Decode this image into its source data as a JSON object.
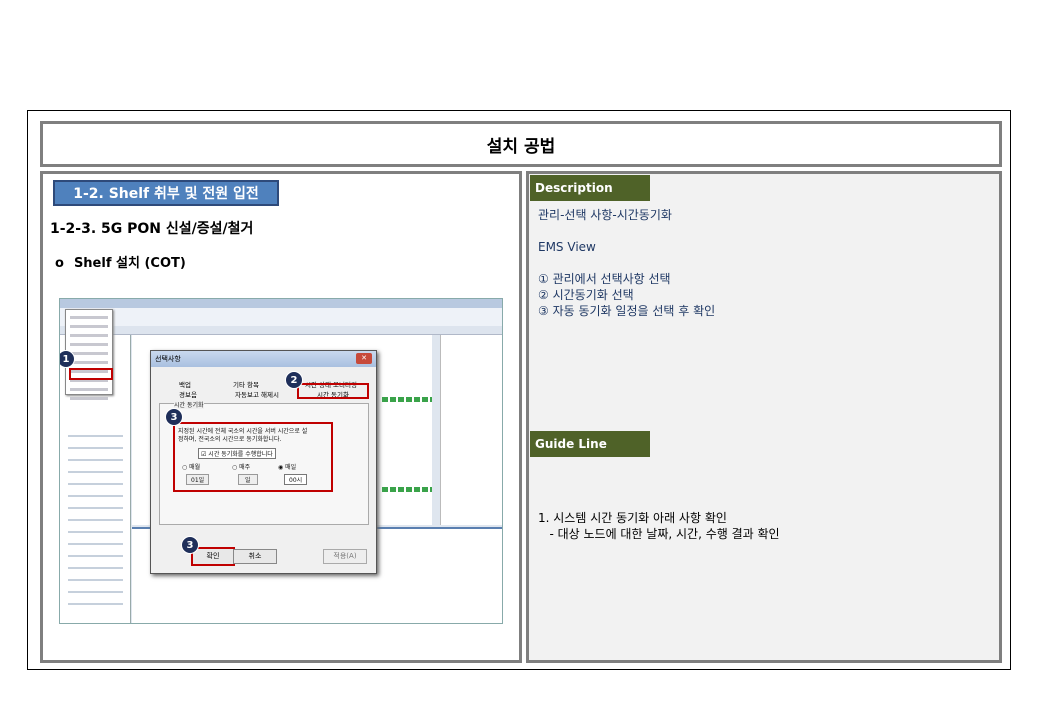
{
  "header": {
    "title": "설치 공법"
  },
  "left": {
    "section_tag": "1-2. Shelf 취부 및 전원 입전",
    "sub_heading": "1-2-3. 5G PON 신설/증설/철거",
    "bullet_symbol": "o",
    "bullet_heading": "Shelf 설치 (COT)",
    "screenshot": {
      "dialog_title": "선택사항",
      "tabs": [
        "백업",
        "기타 항목",
        "시간 상태 모니터링",
        "경보음",
        "자동보고 해제시",
        "시간 동기화"
      ],
      "group_label": "시간 동기화",
      "desc_line1": "지정된 시간에 전체 국소의 시간을 서버 시간으로 설",
      "desc_line2": "정하며, 전국소의 시간으로 동기화합니다.",
      "checkbox_label": "시간 동기화를 수행합니다",
      "radio_options": [
        "매월",
        "매주",
        "매일"
      ],
      "selects": [
        "01일",
        "일",
        "00시"
      ],
      "ok_label": "확인",
      "cancel_label": "취소",
      "apply_label": "적용(A)",
      "badges": [
        "1",
        "2",
        "3",
        "3"
      ]
    }
  },
  "right": {
    "description_tag": "Description",
    "desc_line1": "관리-선택 사항-시간동기화",
    "desc_line2": "EMS View",
    "steps": [
      "① 관리에서 선택사항 선택",
      "② 시간동기화 선택",
      "③ 자동 동기화 일정을 선택 후 확인"
    ],
    "guide_tag": "Guide  Line",
    "guide_line1": "1. 시스템 시간 동기화 아래 사항 확인",
    "guide_line2": "   - 대상 노드에 대한 날짜, 시간, 수행 결과 확인"
  },
  "colors": {
    "section_tag": "#4f81bd",
    "green_tag": "#4f6228",
    "panel_border": "#7f7f7f",
    "highlight": "#c00000",
    "badge": "#1f2f5a"
  }
}
